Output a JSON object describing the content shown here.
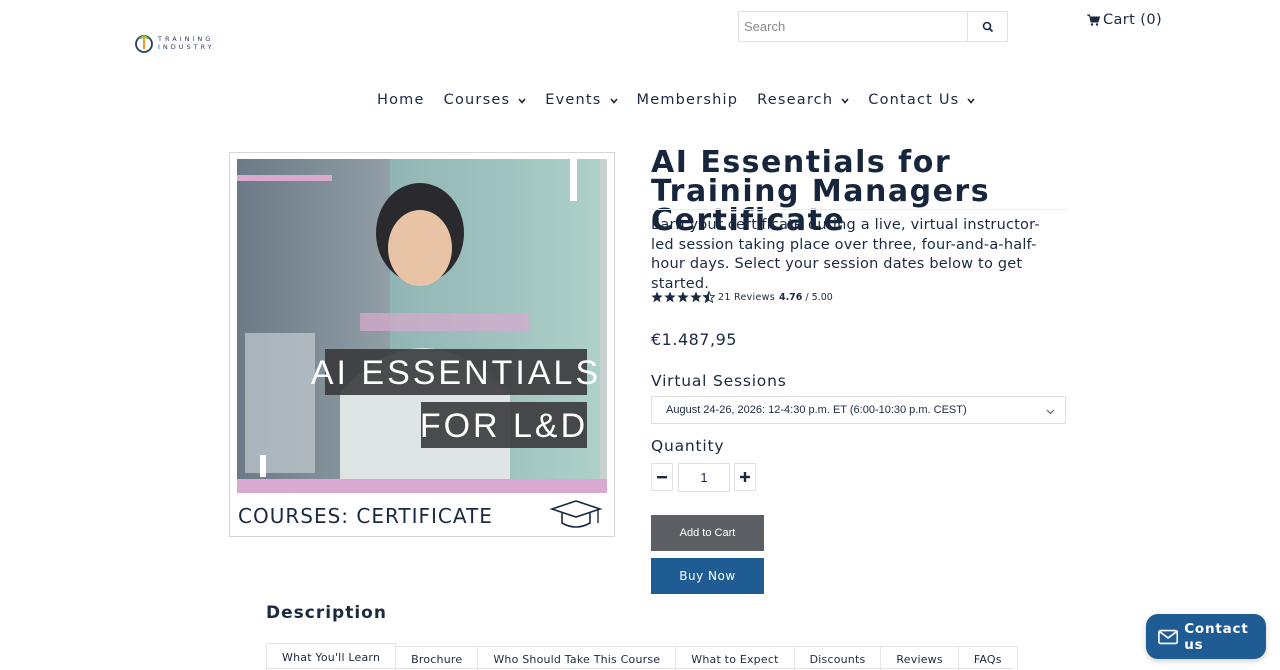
{
  "header": {
    "logo_text_top": "TRAINING",
    "logo_text_bottom": "INDUSTRY",
    "search_placeholder": "Search",
    "cart_label": "Cart (0)"
  },
  "nav": {
    "items": [
      {
        "label": "Home",
        "has_dropdown": false
      },
      {
        "label": "Courses",
        "has_dropdown": true
      },
      {
        "label": "Events",
        "has_dropdown": true
      },
      {
        "label": "Membership",
        "has_dropdown": false
      },
      {
        "label": "Research",
        "has_dropdown": true
      },
      {
        "label": "Contact Us",
        "has_dropdown": true
      }
    ]
  },
  "product": {
    "image": {
      "overlay_line1": "AI ESSENTIALS",
      "overlay_line2": "FOR L&D",
      "footer": "COURSES: CERTIFICATE"
    },
    "title": "AI Essentials for Training Managers Certificate",
    "description": "Earn your certificate during a live, virtual instructor-led session taking place over three, four-and-a-half-hour days. Select your session dates below to get started.",
    "rating": {
      "stars": 4.76,
      "reviews_label": "21 Reviews",
      "average": "4.76",
      "max": "/ 5.00"
    },
    "price": "€1.487,95",
    "sessions_label": "Virtual Sessions",
    "selected_session": "August 24-26, 2026: 12-4:30 p.m. ET (6:00-10:30 p.m. CEST)",
    "quantity_label": "Quantity",
    "quantity": "1",
    "add_to_cart_label": "Add to Cart",
    "buy_now_label": "Buy Now"
  },
  "description_section": {
    "heading": "Description",
    "tabs": [
      "What You'll Learn",
      "Brochure",
      "Who Should Take This Course",
      "What to Expect",
      "Discounts",
      "Reviews",
      "FAQs"
    ],
    "active_tab": 0
  },
  "contact_widget": {
    "label": "Contact us"
  },
  "colors": {
    "text": "#1c2a40",
    "buy_button": "#1f5c93",
    "cart_button": "#5c5f63",
    "image_teal": "#8fd0c4",
    "image_pink": "#d9a9cf"
  }
}
